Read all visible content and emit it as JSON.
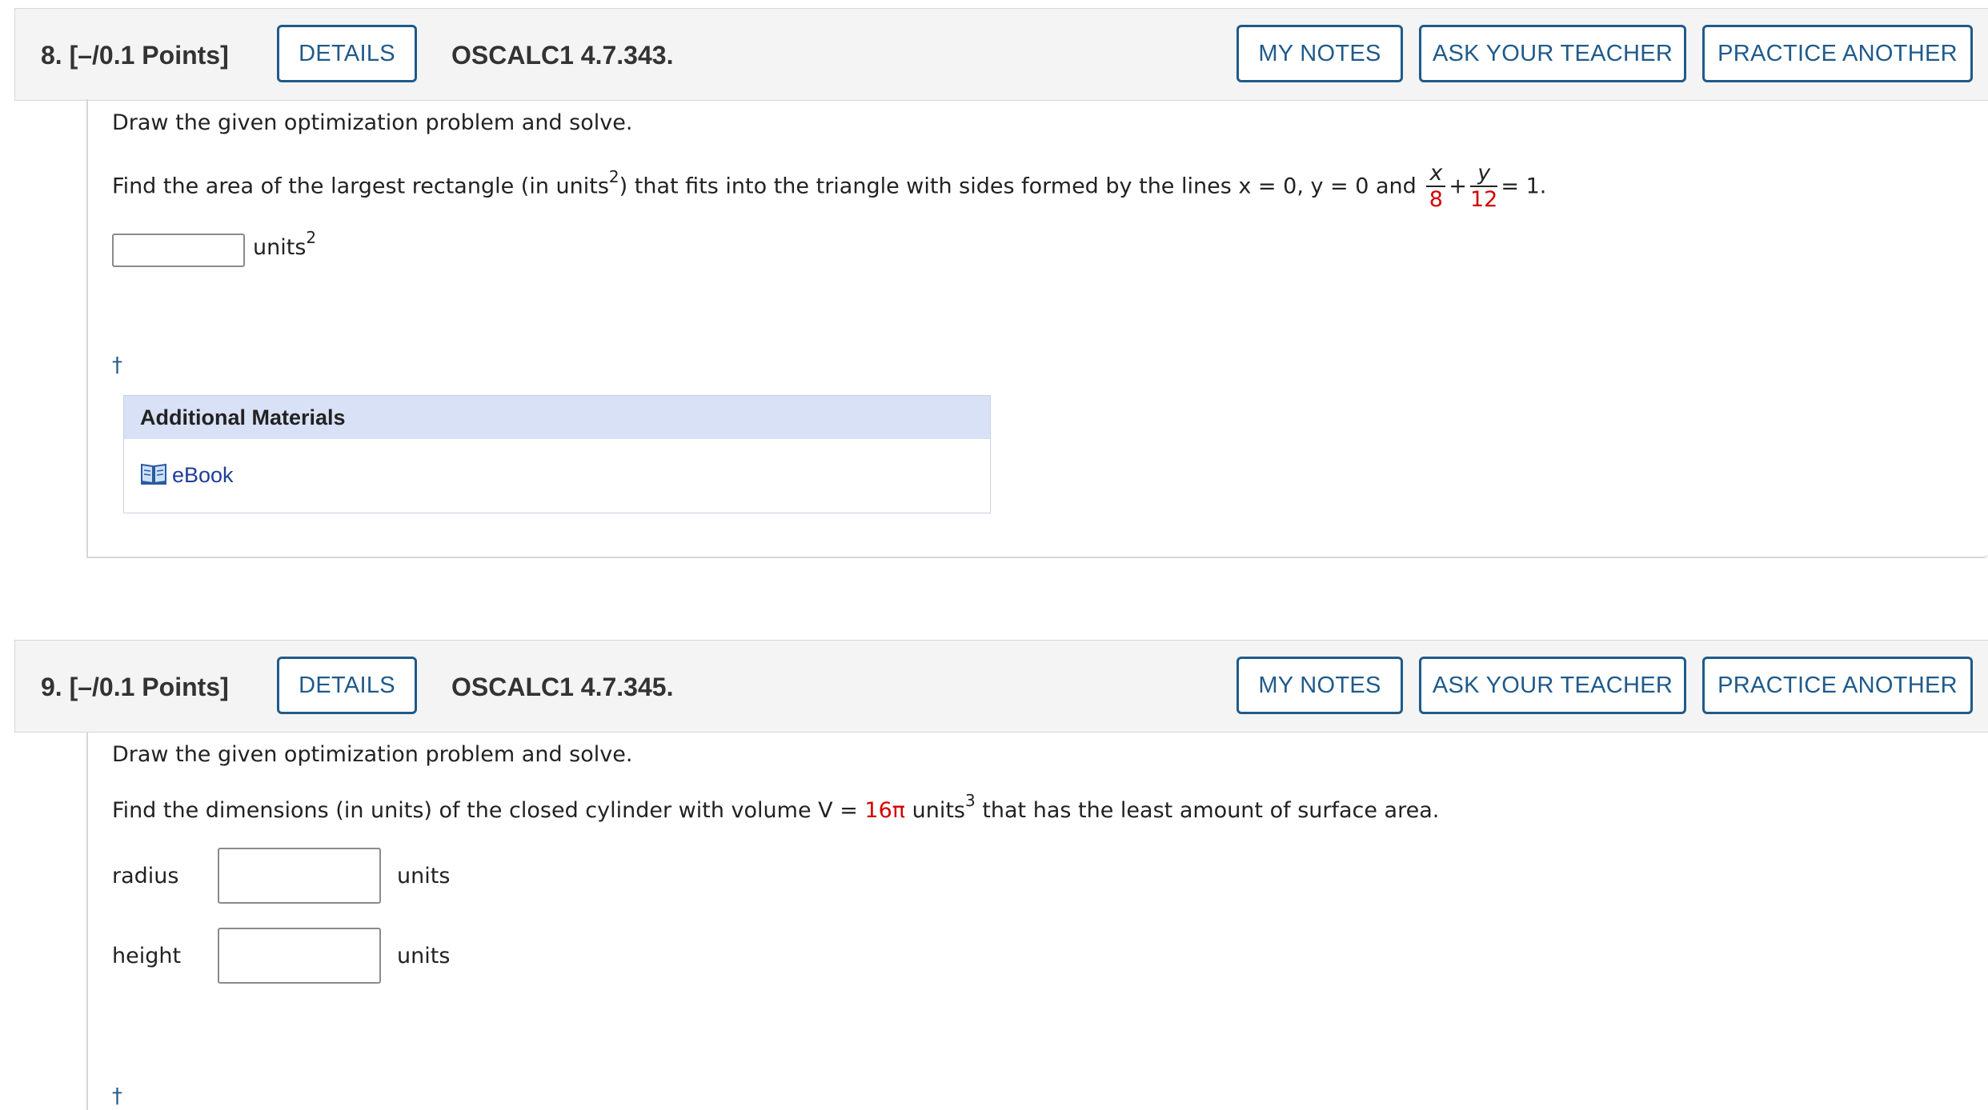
{
  "q8": {
    "number": "8.  [–/0.1 Points]",
    "details_label": "DETAILS",
    "code": "OSCALC1 4.7.343.",
    "my_notes_label": "MY NOTES",
    "ask_teacher_label": "ASK YOUR TEACHER",
    "practice_label": "PRACTICE ANOTHER",
    "instruction": "Draw the given optimization problem and solve.",
    "problem_pre": "Find the area of the largest rectangle (in units",
    "problem_sup": "2",
    "problem_mid": ") that fits into the triangle with sides formed by the lines x = 0, y = 0 and ",
    "frac1_num": "x",
    "frac1_den": "8",
    "plus": "+",
    "frac2_num": "y",
    "frac2_den": "12",
    "problem_end": "= 1.",
    "answer_unit": "units",
    "answer_unit_sup": "2",
    "dagger": "†",
    "materials_title": "Additional Materials",
    "ebook_label": "eBook"
  },
  "q9": {
    "number": "9.  [–/0.1 Points]",
    "details_label": "DETAILS",
    "code": "OSCALC1 4.7.345.",
    "my_notes_label": "MY NOTES",
    "ask_teacher_label": "ASK YOUR TEACHER",
    "practice_label": "PRACTICE ANOTHER",
    "instruction": "Draw the given optimization problem and solve.",
    "problem_pre": "Find the dimensions (in units) of the closed cylinder with volume V = ",
    "volume_value": "16π",
    "problem_unit": " units",
    "problem_sup": "3",
    "problem_end": " that has the least amount of surface area.",
    "radius_label": "radius",
    "radius_unit": "units",
    "height_label": "height",
    "height_unit": "units",
    "dagger": "†"
  },
  "colors": {
    "accent": "#1f5a8a",
    "highlight": "#d40000",
    "materials_header": "#d9e1f7"
  },
  "icons": {
    "ebook": "open-book-icon"
  }
}
